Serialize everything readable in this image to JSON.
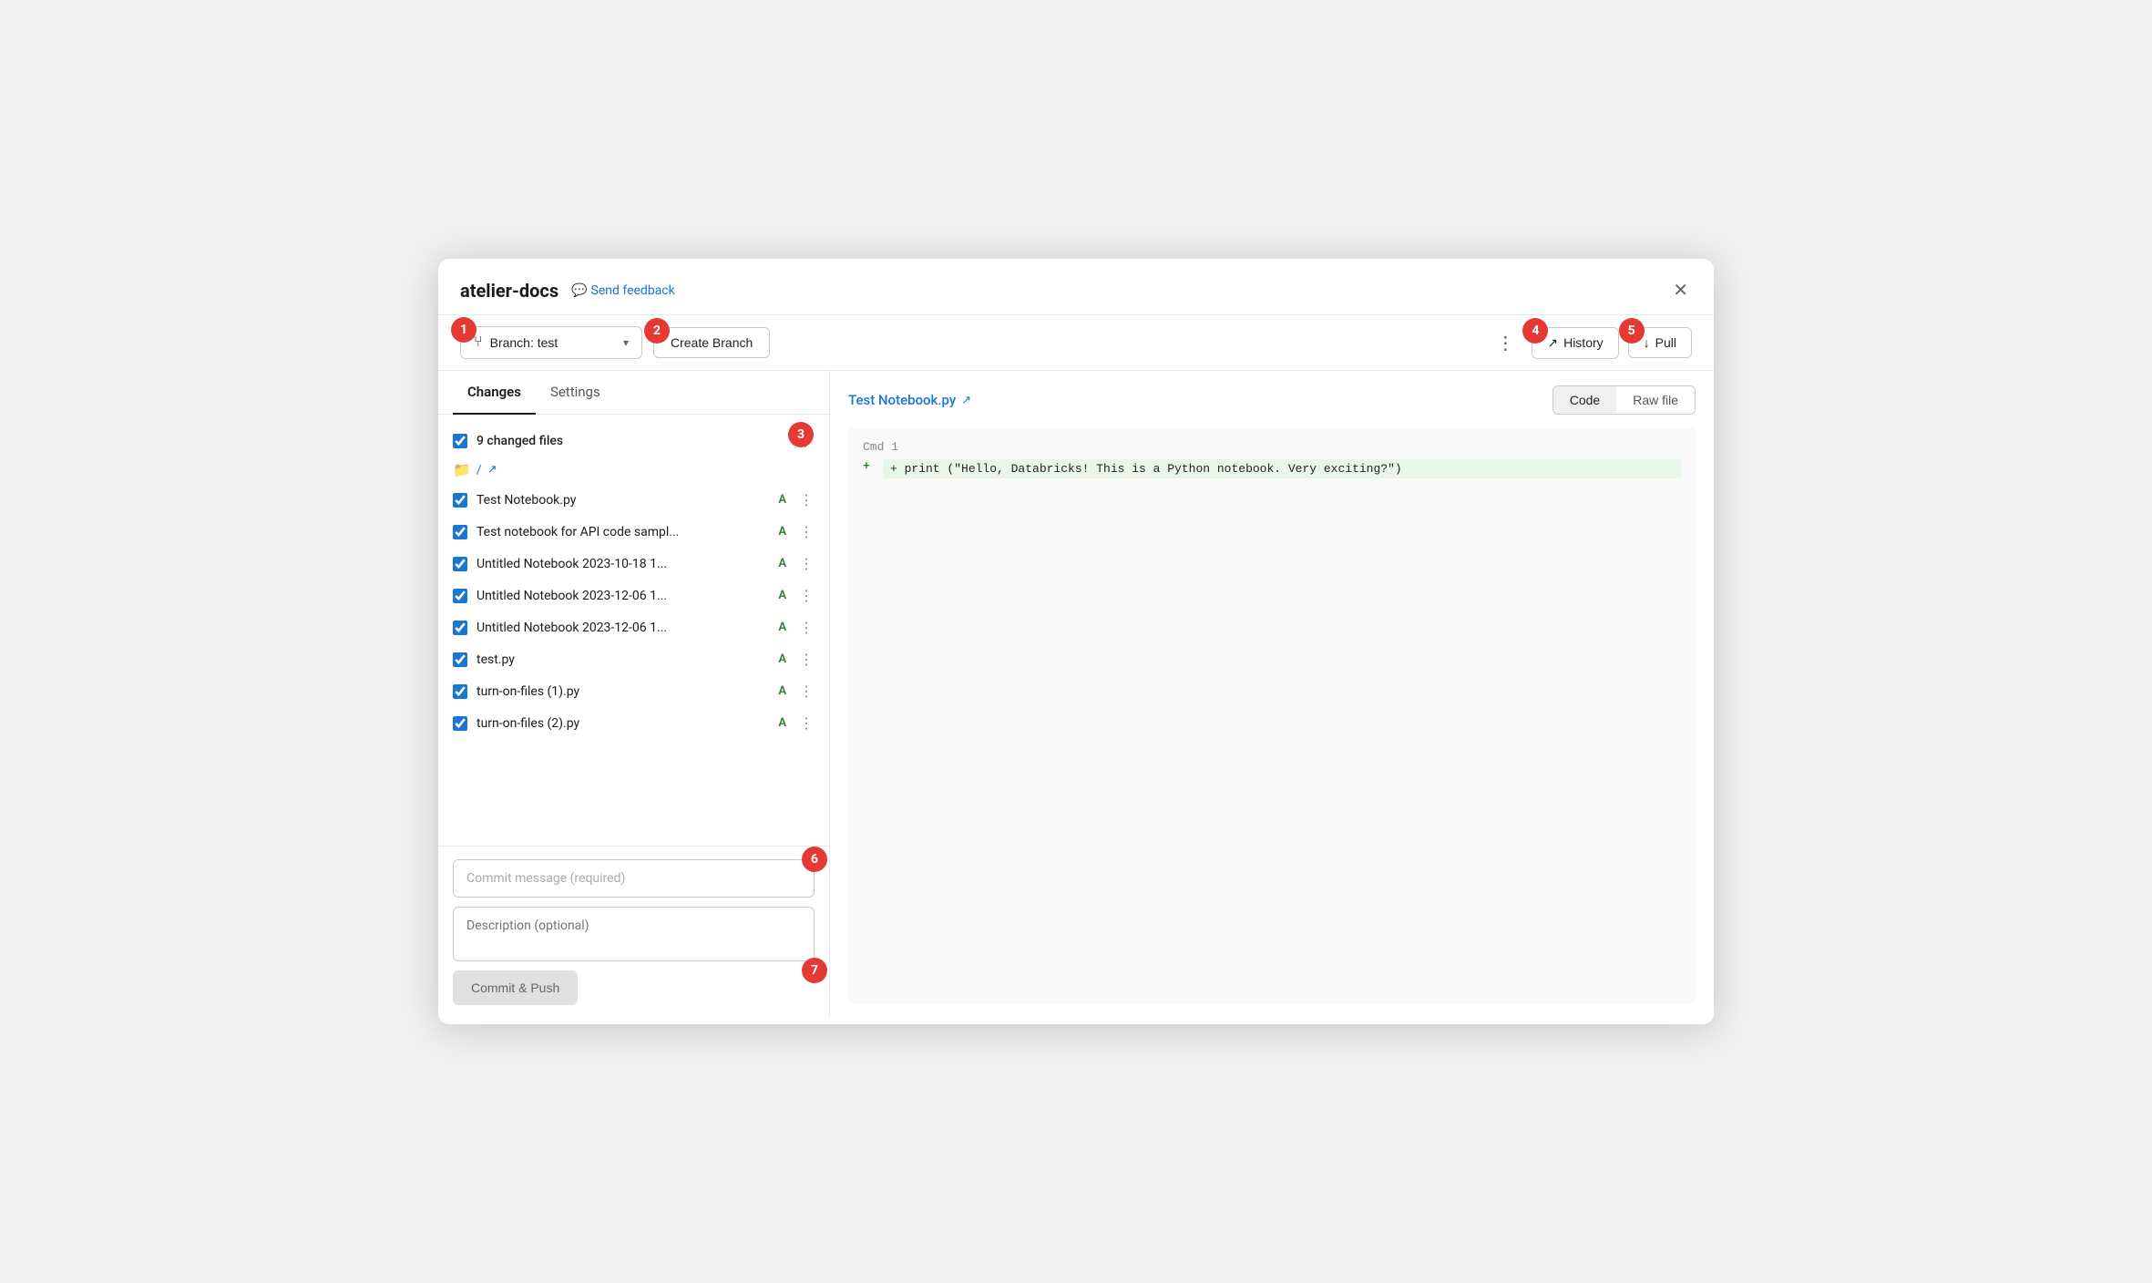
{
  "window": {
    "title": "atelier-docs",
    "feedback_label": "Send feedback"
  },
  "toolbar": {
    "branch_label": "Branch: test",
    "create_branch_label": "Create Branch",
    "more_options_label": "⋮",
    "history_label": "History",
    "pull_label": "Pull"
  },
  "tabs": [
    {
      "label": "Changes",
      "active": true
    },
    {
      "label": "Settings",
      "active": false
    }
  ],
  "files_section": {
    "header_label": "9 changed files",
    "folder_path": "/",
    "files": [
      {
        "name": "Test Notebook.py",
        "badge": "A",
        "checked": true
      },
      {
        "name": "Test notebook for API code sampl...",
        "badge": "A",
        "checked": true
      },
      {
        "name": "Untitled Notebook 2023-10-18 1...",
        "badge": "A",
        "checked": true
      },
      {
        "name": "Untitled Notebook 2023-12-06 1...",
        "badge": "A",
        "checked": true
      },
      {
        "name": "Untitled Notebook 2023-12-06 1...",
        "badge": "A",
        "checked": true
      },
      {
        "name": "test.py",
        "badge": "A",
        "checked": true
      },
      {
        "name": "turn-on-files (1).py",
        "badge": "A",
        "checked": true
      },
      {
        "name": "turn-on-files (2).py",
        "badge": "A",
        "checked": true
      }
    ]
  },
  "commit": {
    "message_placeholder": "Commit message (required)",
    "description_placeholder": "Description (optional)",
    "button_label": "Commit & Push"
  },
  "diff": {
    "file_title": "Test Notebook.py",
    "code_label": "Cmd 1",
    "view_code": "Code",
    "view_raw": "Raw file",
    "diff_line": "+ print (\"Hello, Databricks! This is a Python notebook. Very exciting?\")"
  },
  "badges": {
    "b1": "1",
    "b2": "2",
    "b3": "3",
    "b4": "4",
    "b5": "5",
    "b6": "6",
    "b7": "7"
  },
  "colors": {
    "badge_bg": "#e53935",
    "badge_text": "#ffffff",
    "accent_blue": "#1976d2",
    "green": "#2e7d32"
  }
}
